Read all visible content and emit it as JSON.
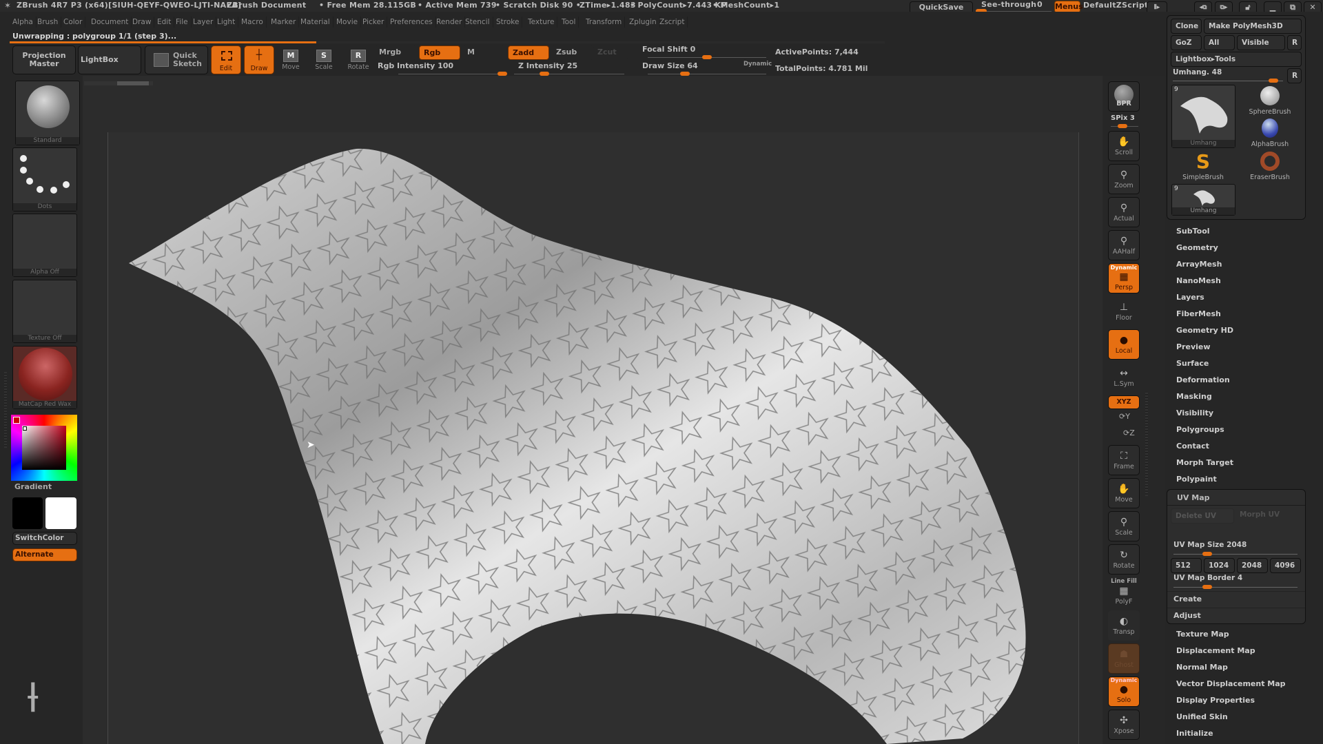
{
  "window": {
    "app_title": "ZBrush 4R7 P3 (x64)[SIUH-QEYF-QWEO-LJTI-NAEA]",
    "document_title": "ZBrush Document",
    "stats": {
      "free_mem": "• Free Mem 28.115GB",
      "active_mem": "• Active Mem 739",
      "scratch_disk": "• Scratch Disk 90 •",
      "ztime": "ZTime▸1.483",
      "polycount": "• PolyCount▸7.443 KP",
      "meshcount": "• MeshCount▸1"
    },
    "quicksave_label": "QuickSave",
    "see_through": {
      "label": "See-through",
      "value": "0",
      "fraction": 0.0
    },
    "menus_label": "Menus",
    "default_script_label": "DefaultZScript",
    "window_icons": [
      "palette-scroll-icon",
      "prev-layout-icon",
      "next-layout-icon",
      "lock-icon",
      "minimize-icon",
      "restore-icon",
      "close-icon"
    ]
  },
  "menubar": [
    "Alpha",
    "Brush",
    "Color",
    "Document",
    "Draw",
    "Edit",
    "File",
    "Layer",
    "Light",
    "Macro",
    "Marker",
    "Material",
    "Movie",
    "Picker",
    "Preferences",
    "Render",
    "Stencil",
    "Stroke",
    "Texture",
    "Tool",
    "Transform",
    "Zplugin",
    "Zscript"
  ],
  "status": {
    "message": "Unwrapping : polygroup 1/1   (step 3)...",
    "progress": 0.35
  },
  "toolbar": {
    "projection_master": "Projection Master",
    "lightbox": "LightBox",
    "quick_sketch": "Quick Sketch",
    "edit": "Edit",
    "draw": "Draw",
    "move": "Move",
    "scale": "Scale",
    "rotate": "Rotate",
    "mrgb": "Mrgb",
    "rgb": "Rgb",
    "m": "M",
    "zadd": "Zadd",
    "zsub": "Zsub",
    "zcut": "Zcut",
    "rgb_intensity": {
      "label": "Rgb Intensity 100",
      "value": 100,
      "fraction": 1.0
    },
    "z_intensity": {
      "label": "Z Intensity 25",
      "value": 25,
      "fraction": 0.25
    },
    "focal_shift": {
      "label": "Focal Shift 0",
      "value": 0,
      "fraction": 0.5
    },
    "draw_size": {
      "label": "Draw Size 64",
      "value": 64,
      "fraction": 0.3
    },
    "dynamic": "Dynamic",
    "active_points": "ActivePoints: 7,444",
    "total_points": "TotalPoints: 4.781 Mil"
  },
  "left_shelf": {
    "brush": "Standard",
    "stroke": "Dots",
    "alpha": "Alpha Off",
    "texture": "Texture Off",
    "material": "MatCap Red Wax",
    "gradient": "Gradient",
    "switch_color": "SwitchColor",
    "alternate": "Alternate",
    "main_color": "#000000",
    "secondary_color": "#ffffff",
    "picker_color": "#cc0000"
  },
  "right_shelf": {
    "bpr": "BPR",
    "spix": {
      "label": "SPix 3",
      "value": 3
    },
    "buttons": [
      "Scroll",
      "Zoom",
      "Actual",
      "AAHalf",
      "Persp",
      "Floor",
      "Local",
      "L.Sym",
      "XYZ",
      "Frame",
      "Move",
      "Scale",
      "Rotate",
      "PolyF",
      "Transp",
      "Ghost",
      "Solo",
      "Xpose"
    ],
    "persp_tag": "Dynamic",
    "polyf_tag": "Line Fill",
    "solo_tag": "Dynamic"
  },
  "tool_palette": {
    "clone": "Clone",
    "make_polymesh": "Make PolyMesh3D",
    "goz": "GoZ",
    "all": "All",
    "visible": "Visible",
    "r": "R",
    "lightbox_tools": "Lightbox▸Tools",
    "umhang_slider": {
      "label": "Umhang. 48",
      "value": 48,
      "fraction": 0.95
    },
    "tools": [
      {
        "name": "Umhang",
        "count": "9"
      },
      {
        "name": "SphereBrush"
      },
      {
        "name": "AlphaBrush"
      },
      {
        "name": "SimpleBrush"
      },
      {
        "name": "EraserBrush"
      },
      {
        "name": "Umhang",
        "count": "9"
      }
    ],
    "sections": [
      "SubTool",
      "Geometry",
      "ArrayMesh",
      "NanoMesh",
      "Layers",
      "FiberMesh",
      "Geometry HD",
      "Preview",
      "Surface",
      "Deformation",
      "Masking",
      "Visibility",
      "Polygroups",
      "Contact",
      "Morph Target",
      "Polypaint"
    ],
    "uv_map": {
      "title": "UV Map",
      "delete_uv": "Delete UV",
      "morph_uv": "Morph UV",
      "size_slider": {
        "label": "UV Map Size 2048",
        "value": 2048,
        "fraction": 0.25
      },
      "size_buttons": [
        "512",
        "1024",
        "2048",
        "4096"
      ],
      "border_slider": {
        "label": "UV Map Border 4",
        "value": 4,
        "fraction": 0.25
      },
      "create": "Create",
      "adjust": "Adjust"
    },
    "sections_after": [
      "Texture Map",
      "Displacement Map",
      "Normal Map",
      "Vector Displacement Map",
      "Display Properties",
      "Unified Skin",
      "Initialize"
    ]
  },
  "colors": {
    "accent": "#e66f12",
    "background": "#262626",
    "canvas": "#2f2f2f"
  }
}
